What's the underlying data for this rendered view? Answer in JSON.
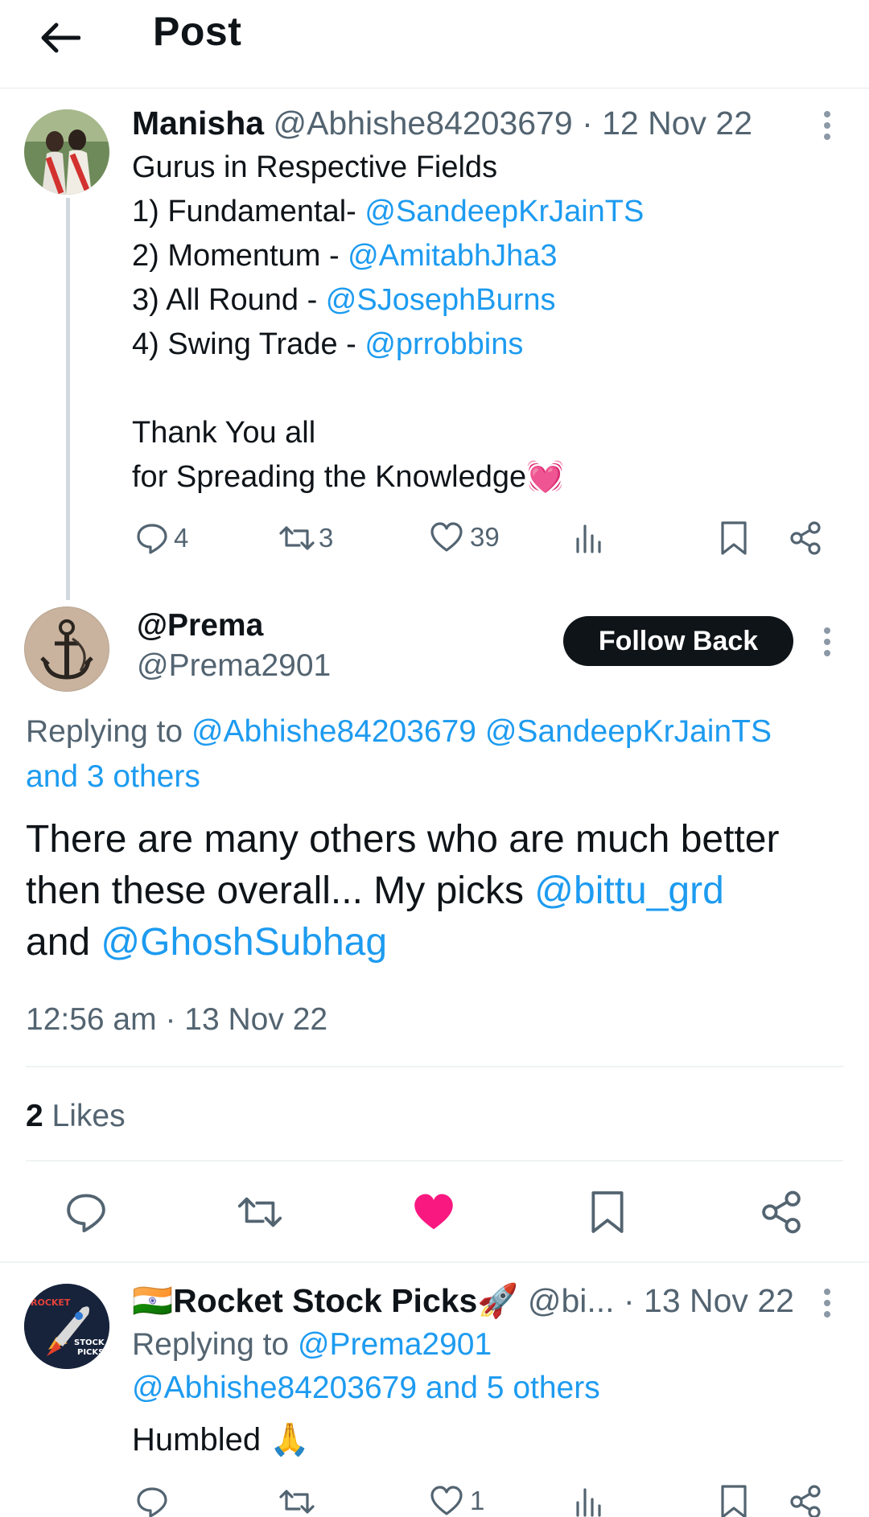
{
  "header": {
    "title": "Post"
  },
  "post1": {
    "display_name": "Manisha",
    "handle": "@Abhishe84203679",
    "sep": "·",
    "date": "12 Nov 22",
    "line1": "Gurus in Respective Fields",
    "lines": [
      {
        "prefix": "1) Fundamental- ",
        "mention": "@SandeepKrJainTS"
      },
      {
        "prefix": "2) Momentum  - ",
        "mention": "@AmitabhJha3"
      },
      {
        "prefix": "3) All Round - ",
        "mention": "@SJosephBurns"
      },
      {
        "prefix": "4) Swing Trade - ",
        "mention": "@prrobbins"
      }
    ],
    "thanks1": "Thank You all",
    "thanks2": "for Spreading the Knowledge",
    "emoji": "💓",
    "replies": "4",
    "reposts": "3",
    "likes": "39"
  },
  "focus": {
    "display_name": "@Prema",
    "handle": "@Prema2901",
    "follow_label": "Follow Back",
    "replying_prefix": "Replying to ",
    "reply_mention1": "@Abhishe84203679",
    "reply_mention2": "@SandeepKrJainTS",
    "reply_others": "and 3 others",
    "text1": "There are many others who are much better",
    "text2_prefix": "then these overall... My picks ",
    "text2_mention": "@bittu_grd",
    "text3_prefix": "and ",
    "text3_mention": "@GhoshSubhag",
    "time": "12:56 am",
    "sep": "·",
    "date": "13 Nov 22",
    "likes_count": "2",
    "likes_label": "Likes",
    "liked_color": "#f91880"
  },
  "reply": {
    "flag": "🇮🇳",
    "display_name": "Rocket Stock Picks",
    "rocket": "🚀",
    "handle": "@bi...",
    "sep": "·",
    "date": "13 Nov 22",
    "replying_prefix": "Replying to ",
    "mention1": "@Prema2901",
    "mention2": "@Abhishe84203679",
    "others": "and 5 others",
    "text": "Humbled",
    "emoji": "🙏",
    "likes": "1",
    "avatar_text1": "ROCKET",
    "avatar_text2": "STOCK",
    "avatar_text3": "PICKS"
  }
}
